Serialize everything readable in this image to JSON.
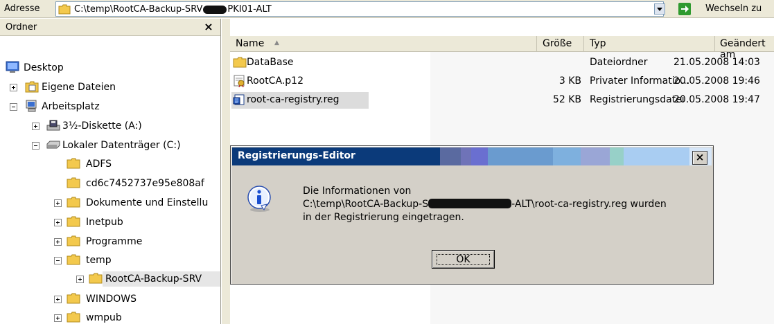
{
  "addressbar": {
    "label": "Adresse",
    "path_prefix": "C:\\temp\\RootCA-Backup-SRV",
    "path_suffix": "PKI01-ALT",
    "go_label": "Wechseln zu"
  },
  "folder_pane": {
    "title": "Ordner",
    "close_glyph": "×",
    "items": [
      {
        "label": "Desktop",
        "icon": "desktop-icon"
      },
      {
        "label": "Eigene Dateien",
        "icon": "my-documents-icon"
      },
      {
        "label": "Arbeitsplatz",
        "icon": "my-computer-icon"
      },
      {
        "label": "3½-Diskette (A:)",
        "icon": "floppy-drive-icon"
      },
      {
        "label": "Lokaler Datenträger (C:)",
        "icon": "hard-drive-icon"
      },
      {
        "label": "ADFS",
        "icon": "folder-icon"
      },
      {
        "label": "cd6c7452737e95e808af",
        "icon": "folder-icon"
      },
      {
        "label": "Dokumente und Einstellu",
        "icon": "folder-icon"
      },
      {
        "label": "Inetpub",
        "icon": "folder-icon"
      },
      {
        "label": "Programme",
        "icon": "folder-icon"
      },
      {
        "label": "temp",
        "icon": "folder-icon"
      },
      {
        "label": "RootCA-Backup-SRV",
        "icon": "folder-icon"
      },
      {
        "label": "WINDOWS",
        "icon": "folder-icon"
      },
      {
        "label": "wmpub",
        "icon": "folder-icon"
      }
    ]
  },
  "file_list": {
    "columns": [
      "Name",
      "Größe",
      "Typ",
      "Geändert am"
    ],
    "sort_glyph": "▲",
    "rows": [
      {
        "name": "DataBase",
        "size": "",
        "type": "Dateiordner",
        "modified": "21.05.2008 14:03",
        "icon": "folder-icon"
      },
      {
        "name": "RootCA.p12",
        "size": "3 KB",
        "type": "Privater Informatio...",
        "modified": "20.05.2008 19:46",
        "icon": "certificate-file-icon"
      },
      {
        "name": "root-ca-registry.reg",
        "size": "52 KB",
        "type": "Registrierungsdatei",
        "modified": "20.05.2008 19:47",
        "icon": "registry-file-icon"
      }
    ]
  },
  "dialog": {
    "title": "Registrierungs-Editor",
    "close_glyph": "×",
    "line1": "Die Informationen von",
    "line2_prefix": "C:\\temp\\RootCA-Backup-S",
    "line2_suffix": "-ALT\\root-ca-registry.reg wurden",
    "line3": "in der Registrierung eingetragen.",
    "ok_label": "OK"
  },
  "colors": {
    "titlebar": "#0a246a",
    "dialog_bg": "#d4d0c8",
    "chrome_bg": "#ece9d8"
  }
}
